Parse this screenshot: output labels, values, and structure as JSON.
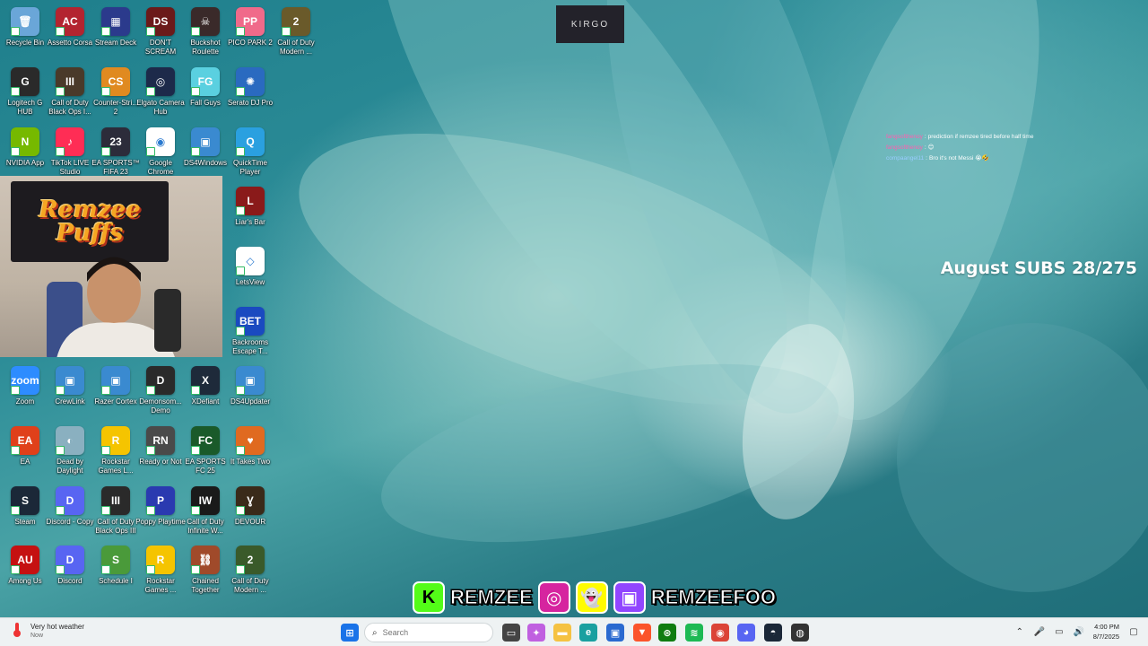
{
  "overlay": {
    "kirgo_logo": "KIRGO",
    "webcam_banner": "Remzee Puffs",
    "subs_goal": "August SUBS 28/275",
    "chat": [
      {
        "user": "fangsofthenoy",
        "sep": ":",
        "msg": "prediction if remzee tired before half time"
      },
      {
        "user": "fangsofthenoy",
        "sep": ":",
        "msg": "😊"
      },
      {
        "user": "compaangel11",
        "sep": ":",
        "msg": "Bro it's not Messi 😭🤣"
      }
    ],
    "socials": [
      {
        "icon": "kick-icon",
        "letter": "K",
        "color": "#53fc18",
        "handle": "REMZEE"
      },
      {
        "icon": "instagram-icon",
        "letter": "◎",
        "color": "#d6249f",
        "handle": ""
      },
      {
        "icon": "snapchat-icon",
        "letter": "👻",
        "color": "#fffc00",
        "handle": ""
      },
      {
        "icon": "twitch-icon",
        "letter": "▣",
        "color": "#9146ff",
        "handle": "REMZEEFOO"
      }
    ]
  },
  "desktop_icons": [
    {
      "label": "Recycle Bin",
      "color": "#6aa6d8",
      "glyph": "🗑"
    },
    {
      "label": "Assetto Corsa",
      "color": "#b32430",
      "glyph": "AC"
    },
    {
      "label": "Stream Deck",
      "color": "#2b3a8c",
      "glyph": "▦"
    },
    {
      "label": "DON'T SCREAM",
      "color": "#6b1a1a",
      "glyph": "DS"
    },
    {
      "label": "Buckshot Roulette",
      "color": "#3a2a2a",
      "glyph": "☠"
    },
    {
      "label": "PICO PARK 2",
      "color": "#f06a8a",
      "glyph": "PP"
    },
    {
      "label": "Call of Duty Modern ...",
      "color": "#6a5a2a",
      "glyph": "2"
    },
    {
      "label": "Logitech G HUB",
      "color": "#2a2a2a",
      "glyph": "G"
    },
    {
      "label": "Call of Duty Black Ops I...",
      "color": "#4a3a2a",
      "glyph": "III"
    },
    {
      "label": "Counter-Stri... 2",
      "color": "#e08a20",
      "glyph": "CS"
    },
    {
      "label": "Elgato Camera Hub",
      "color": "#1d2a4a",
      "glyph": "◎"
    },
    {
      "label": "Fall Guys",
      "color": "#5ad0e0",
      "glyph": "FG"
    },
    {
      "label": "Serato DJ Pro",
      "color": "#2a6ac0",
      "glyph": "✺"
    },
    {
      "label": "NVIDIA App",
      "color": "#76b900",
      "glyph": "N"
    },
    {
      "label": "TikTok LIVE Studio",
      "color": "#ff2d55",
      "glyph": "♪"
    },
    {
      "label": "EA SPORTS™ FIFA 23",
      "color": "#2c2c3a",
      "glyph": "23"
    },
    {
      "label": "Google Chrome",
      "color": "#ffffff",
      "glyph": "◉"
    },
    {
      "label": "DS4Windows",
      "color": "#3a8ad0",
      "glyph": "▣"
    },
    {
      "label": "QuickTime Player",
      "color": "#2aa0e0",
      "glyph": "Q"
    },
    {
      "label": "Liar's Bar",
      "color": "#8a1a1a",
      "glyph": "L"
    },
    {
      "label": "LetsView",
      "color": "#ffffff",
      "glyph": "◇"
    },
    {
      "label": "Backrooms Escape T...",
      "color": "#1a4ac0",
      "glyph": "BET"
    },
    {
      "label": "Zoom",
      "color": "#2d8cff",
      "glyph": "zoom"
    },
    {
      "label": "CrewLink",
      "color": "#3a8ad0",
      "glyph": "▣"
    },
    {
      "label": "Razer Cortex",
      "color": "#3a8ad0",
      "glyph": "▣"
    },
    {
      "label": "Demonsom... Demo",
      "color": "#2a2a2a",
      "glyph": "D"
    },
    {
      "label": "XDefiant",
      "color": "#1e2a3a",
      "glyph": "X"
    },
    {
      "label": "DS4Updater",
      "color": "#3a8ad0",
      "glyph": "▣"
    },
    {
      "label": "EA",
      "color": "#e0401a",
      "glyph": "EA"
    },
    {
      "label": "Dead by Daylight",
      "color": "#8ab0c0",
      "glyph": "◐"
    },
    {
      "label": "Rockstar Games L...",
      "color": "#f5c400",
      "glyph": "R"
    },
    {
      "label": "Ready or Not",
      "color": "#4a4a4a",
      "glyph": "RN"
    },
    {
      "label": "EA SPORTS FC 25",
      "color": "#1a5a2a",
      "glyph": "FC"
    },
    {
      "label": "It Takes Two",
      "color": "#e06a20",
      "glyph": "♥"
    },
    {
      "label": "Steam",
      "color": "#1b2838",
      "glyph": "S"
    },
    {
      "label": "Discord - Copy",
      "color": "#5865f2",
      "glyph": "D"
    },
    {
      "label": "Call of Duty Black Ops III",
      "color": "#2a2a2a",
      "glyph": "III"
    },
    {
      "label": "Poppy Playtime",
      "color": "#2a3ab0",
      "glyph": "P"
    },
    {
      "label": "Call of Duty Infinite W...",
      "color": "#1a1a1a",
      "glyph": "IW"
    },
    {
      "label": "DEVOUR",
      "color": "#3a2a1a",
      "glyph": "Ɣ"
    },
    {
      "label": "Among Us",
      "color": "#c51111",
      "glyph": "AU"
    },
    {
      "label": "Discord",
      "color": "#5865f2",
      "glyph": "D"
    },
    {
      "label": "Schedule I",
      "color": "#4a9a3a",
      "glyph": "S"
    },
    {
      "label": "Rockstar Games ...",
      "color": "#f5c400",
      "glyph": "R"
    },
    {
      "label": "Chained Together",
      "color": "#a04a2a",
      "glyph": "⛓"
    },
    {
      "label": "Call of Duty Modern ...",
      "color": "#3a5a2a",
      "glyph": "2"
    }
  ],
  "taskbar": {
    "weather_text": "Very hot weather",
    "weather_sub": "Now",
    "search_placeholder": "Search",
    "time": "4:00 PM",
    "date": "8/7/2025",
    "pinned": [
      {
        "name": "start-button",
        "glyph": "⊞",
        "color": "#1a73e8"
      },
      {
        "name": "task-view",
        "glyph": "▭",
        "color": "#444"
      },
      {
        "name": "copilot",
        "glyph": "✦",
        "color": "#c060e0"
      },
      {
        "name": "file-explorer",
        "glyph": "▬",
        "color": "#f5c242"
      },
      {
        "name": "edge",
        "glyph": "e",
        "color": "#1aa0a0"
      },
      {
        "name": "ms-store",
        "glyph": "▣",
        "color": "#2a6ad0"
      },
      {
        "name": "brave",
        "glyph": "▼",
        "color": "#fb542b"
      },
      {
        "name": "xbox",
        "glyph": "⊛",
        "color": "#107c10"
      },
      {
        "name": "spotify",
        "glyph": "≋",
        "color": "#1db954"
      },
      {
        "name": "chrome",
        "glyph": "◉",
        "color": "#db4437"
      },
      {
        "name": "discord",
        "glyph": "◕",
        "color": "#5865f2"
      },
      {
        "name": "steam",
        "glyph": "◓",
        "color": "#1b2838"
      },
      {
        "name": "app-red-dot",
        "glyph": "◍",
        "color": "#333"
      }
    ]
  }
}
